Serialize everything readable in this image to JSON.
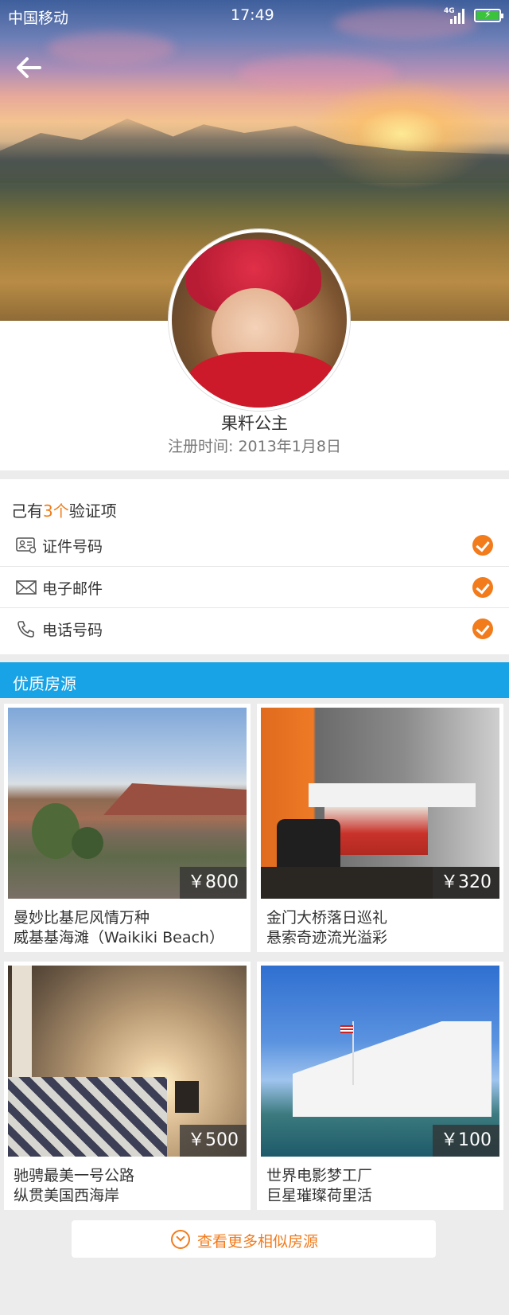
{
  "status_bar": {
    "carrier": "中国移动",
    "time": "17:49",
    "network": "4G",
    "battery_color": "#3cc33c"
  },
  "header": {
    "back_icon": "arrow-left-icon"
  },
  "profile": {
    "name": "果粁公主",
    "registered": "注册时间: 2013年1月8日"
  },
  "verification": {
    "title_prefix": "己有",
    "title_count": "3个",
    "title_suffix": "验证项",
    "items": [
      {
        "label": "证件号码",
        "icon": "id-card-icon",
        "verified": true
      },
      {
        "label": "电子邮件",
        "icon": "mail-icon",
        "verified": true
      },
      {
        "label": "电话号码",
        "icon": "phone-icon",
        "verified": true
      }
    ]
  },
  "listings": {
    "section_title": "优质房源",
    "accent": "#17a3e5",
    "items": [
      {
        "price": "￥800",
        "line1": "曼妙比基尼风情万种",
        "line2": "威基基海滩（Waikiki Beach）"
      },
      {
        "price": "￥320",
        "line1": "金门大桥落日巡礼",
        "line2": "悬索奇迹流光溢彩"
      },
      {
        "price": "￥500",
        "line1": "驰骋最美一号公路",
        "line2": "纵贯美国西海岸"
      },
      {
        "price": "￥100",
        "line1": "世界电影梦工厂",
        "line2": "巨星璀璨荷里活"
      }
    ]
  },
  "more_button": {
    "label": "查看更多相似房源",
    "color": "#f27b1b"
  }
}
